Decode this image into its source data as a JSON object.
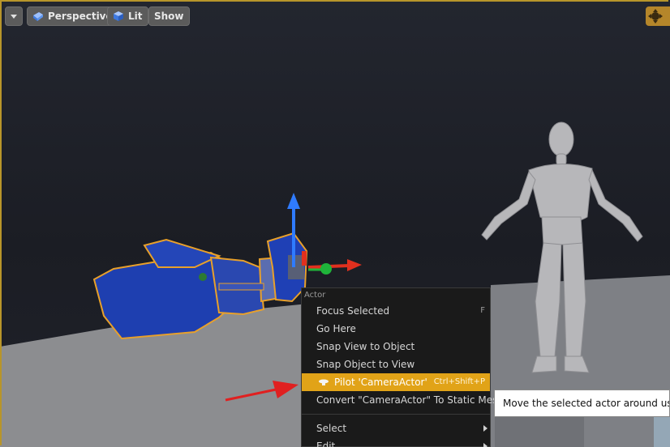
{
  "toolbar": {
    "perspective_label": "Perspective",
    "lit_label": "Lit",
    "show_label": "Show"
  },
  "context_menu": {
    "section_label": "Actor",
    "items": [
      {
        "label": "Focus Selected",
        "shortcut": "F"
      },
      {
        "label": "Go Here",
        "shortcut": ""
      },
      {
        "label": "Snap View to Object",
        "shortcut": ""
      },
      {
        "label": "Snap Object to View",
        "shortcut": ""
      },
      {
        "label": "Pilot 'CameraActor'",
        "shortcut": "Ctrl+Shift+P",
        "highlighted": true
      },
      {
        "label": "Convert \"CameraActor\" To Static Mesh",
        "shortcut": ""
      },
      {
        "label": "Select",
        "submenu": true
      },
      {
        "label": "Edit",
        "submenu": true
      }
    ]
  },
  "tooltip": {
    "text": "Move the selected actor around using t"
  },
  "colors": {
    "selection_outline": "#e8a02a",
    "menu_highlight": "#e1a318",
    "gizmo_z": "#2f7bff",
    "gizmo_x": "#e0301e",
    "gizmo_y": "#1fb43a",
    "annotation_arrow": "#e02020"
  }
}
